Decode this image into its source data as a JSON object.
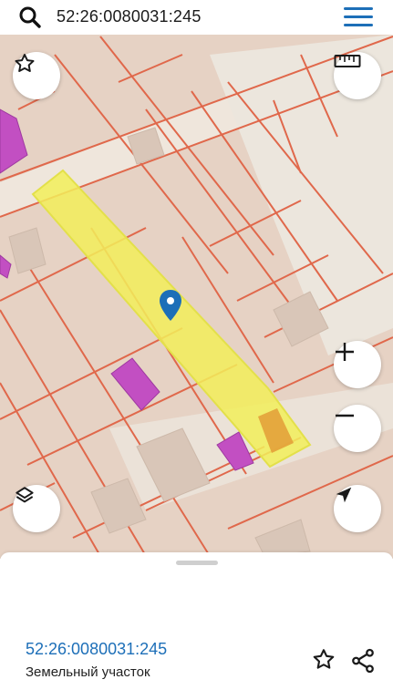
{
  "search": {
    "query": "52:26:0080031:245",
    "icon": "search-icon"
  },
  "header": {
    "menu_icon": "hamburger-menu-icon"
  },
  "map": {
    "highlighted_parcel_color": "#f2ef5a",
    "parcel_border_color": "#e0684b",
    "building_color": "#c24fc2",
    "marker_color": "#1d6fb8"
  },
  "controls": {
    "favorites": "star-icon",
    "ruler": "ruler-icon",
    "zoom_in": "plus-icon",
    "zoom_out": "minus-icon",
    "layers": "layers-icon",
    "locate": "navigation-arrow-icon"
  },
  "sheet": {
    "cadastral_number": "52:26:0080031:245",
    "type": "Земельный участок",
    "accent": "#1d6fb8"
  }
}
